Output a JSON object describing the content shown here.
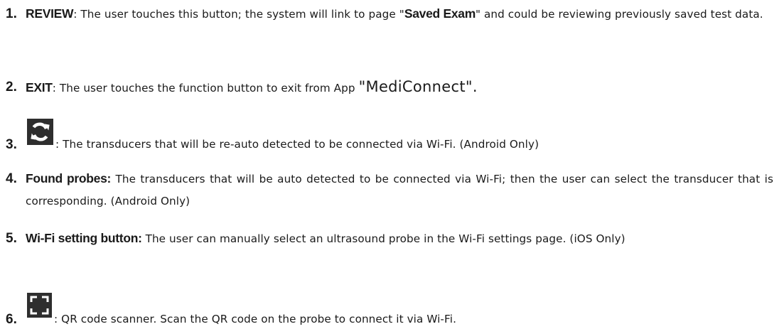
{
  "items": [
    {
      "number": "1.",
      "keyword": "REVIEW",
      "text_a": ": The user touches this button; the system will link to page \"",
      "highlight": "Saved Exam",
      "text_b": "\" and could be reviewing previously saved test data."
    },
    {
      "number": "2.",
      "keyword": "EXIT",
      "text_a": ": The user touches the function button to exit from App ",
      "highlight": "\"MediConnect\".",
      "text_b": ""
    },
    {
      "number": "3.",
      "icon": "refresh-icon",
      "text": ": The transducers that will be re-auto detected to be connected via Wi-Fi. (Android Only)"
    },
    {
      "number": "4.",
      "keyword": "Found probes:",
      "text": " The transducers that will be auto detected to be connected via Wi-Fi; then the user can select the transducer that is corresponding. (Android Only)"
    },
    {
      "number": "5.",
      "keyword": "Wi-Fi setting button:",
      "text": " The user can manually select an ultrasound probe in the Wi-Fi settings page. (iOS Only)"
    },
    {
      "number": "6.",
      "icon": "qr-scan-icon",
      "text": ": QR code scanner. Scan the QR code on the probe to connect it via Wi-Fi."
    }
  ],
  "colors": {
    "text": "#1a1a1a",
    "icon_bg": "#2e2e2e",
    "icon_fg": "#ffffff"
  }
}
